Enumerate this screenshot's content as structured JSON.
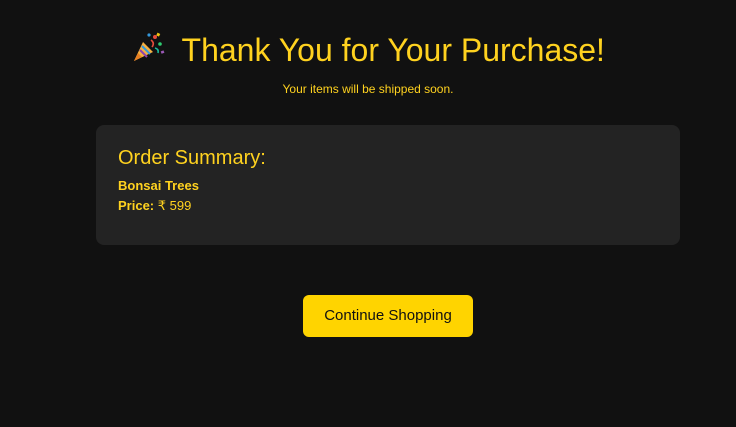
{
  "header": {
    "icon": "party-popper-icon",
    "title": "Thank You for Your Purchase!",
    "subtitle": "Your items will be shipped soon."
  },
  "order_summary": {
    "heading": "Order Summary:",
    "item_name": "Bonsai Trees",
    "price_label": "Price:",
    "price_value": "₹ 599"
  },
  "actions": {
    "continue_label": "Continue Shopping"
  },
  "colors": {
    "background": "#111111",
    "card": "#232323",
    "accent": "#FFD21F",
    "button": "#FFD400",
    "button_text": "#111111"
  }
}
